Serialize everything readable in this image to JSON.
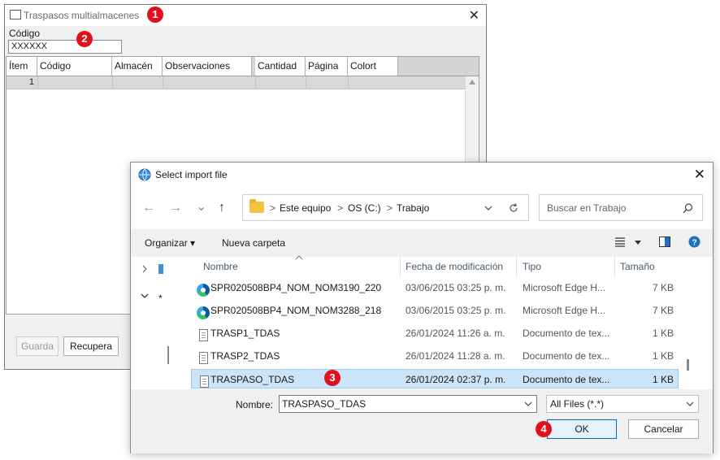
{
  "bg_window": {
    "title": "Traspasos multialmacenes",
    "close_glyph": "✕",
    "code_label": "Código",
    "code_value": "XXXXXX",
    "grid": {
      "headers": [
        "Ítem",
        "Código",
        "Almacén",
        "Observaciones",
        "Cantidad",
        "Página",
        "Colort"
      ],
      "rows": [
        {
          "item": "1"
        }
      ]
    },
    "buttons": {
      "save": "Guarda",
      "recover": "Recupera"
    }
  },
  "dialog": {
    "title": "Select import file",
    "close_glyph": "✕",
    "nav": {
      "back": "←",
      "forward": "→",
      "recent": "⌄",
      "up": "↑"
    },
    "breadcrumb": [
      "Este equipo",
      "OS (C:)",
      "Trabajo"
    ],
    "breadcrumb_sep": ">",
    "search_placeholder": "Buscar en Trabajo",
    "toolbar": {
      "organize": "Organizar ▾",
      "new_folder": "Nueva carpeta"
    },
    "columns": {
      "name": "Nombre",
      "date": "Fecha de modificación",
      "type": "Tipo",
      "size": "Tamaño"
    },
    "files": [
      {
        "name": "SPR020508BP4_NOM_NOM3190_220",
        "date": "03/06/2015 03:25 p. m.",
        "type": "Microsoft Edge H...",
        "size": "7 KB",
        "icon": "edge-icon"
      },
      {
        "name": "SPR020508BP4_NOM_NOM3288_218",
        "date": "03/06/2015 03:25 p. m.",
        "type": "Microsoft Edge H...",
        "size": "7 KB",
        "icon": "edge-icon"
      },
      {
        "name": "TRASP1_TDAS",
        "date": "26/01/2024 11:26 a. m.",
        "type": "Documento de tex...",
        "size": "1 KB",
        "icon": "text-file-icon"
      },
      {
        "name": "TRASP2_TDAS",
        "date": "26/01/2024 11:28 a. m.",
        "type": "Documento de tex...",
        "size": "1 KB",
        "icon": "text-file-icon"
      },
      {
        "name": "TRASPASO_TDAS",
        "date": "26/01/2024 02:37 p. m.",
        "type": "Documento de tex...",
        "size": "1 KB",
        "icon": "text-file-icon",
        "selected": true
      }
    ],
    "filename_label": "Nombre:",
    "filename_value": "TRASPASO_TDAS",
    "filter_value": "All Files (*.*)",
    "ok": "OK",
    "cancel": "Cancelar"
  },
  "callouts": [
    "1",
    "2",
    "3",
    "4"
  ],
  "colors": {
    "callout": "#e0111b",
    "selection": "#cce4f7",
    "primary_border": "#0067c0"
  }
}
